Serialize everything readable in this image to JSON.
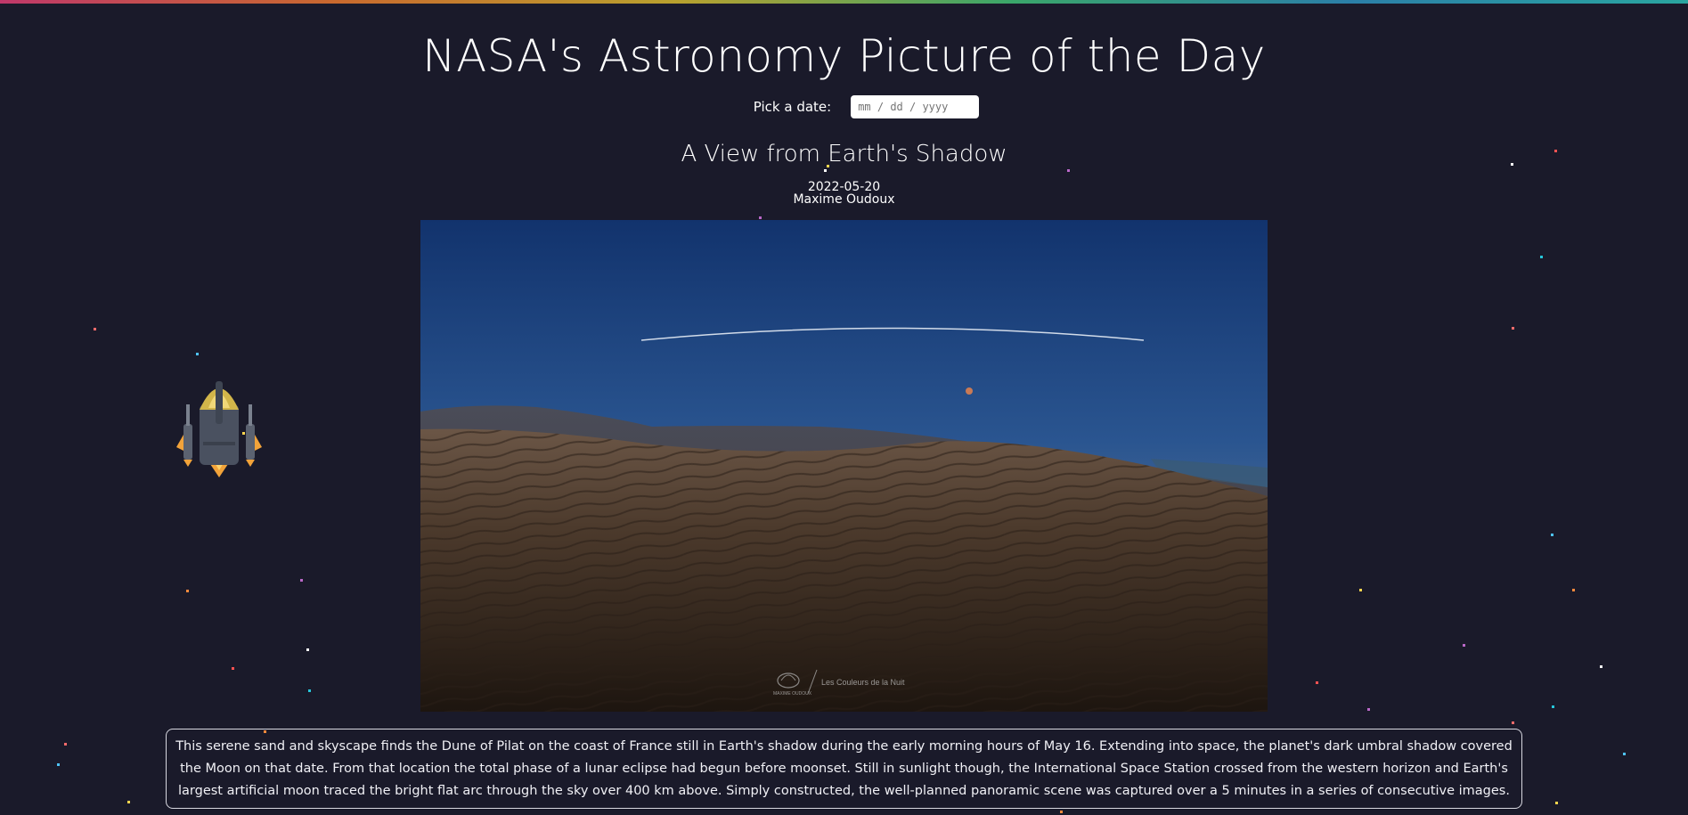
{
  "page": {
    "title": "NASA's Astronomy Picture of the Day"
  },
  "date_picker": {
    "label": "Pick a date:",
    "placeholder": "mm / dd / yyyy",
    "value": ""
  },
  "apod": {
    "title": "A View from Earth's Shadow",
    "date": "2022-05-20",
    "copyright": "Maxime Oudoux",
    "image_alt": "A View from Earth's Shadow",
    "watermark_text": "Les Couleurs de la Nuit",
    "watermark_logo_text": "MAXIME OUDOUX",
    "explanation": "This serene sand and skyscape finds the Dune of Pilat on the coast of France still in Earth's shadow during the early morning hours of May 16. Extending into space, the planet's dark umbral shadow covered the Moon on that date. From that location the total phase of a lunar eclipse had begun before moonset. Still in sunlight though, the International Space Station crossed from the western horizon and Earth's largest artificial moon traced the bright flat arc through the sky over 400 km above. Simply constructed, the well-planned panoramic scene was captured over a 5 minutes in a series of consecutive images."
  },
  "decorations": {
    "rocket_icon": "rocket-icon",
    "star_colors": [
      "#ff6b6b",
      "#4fc3f7",
      "#ffd54f",
      "#ff8a3d",
      "#ba68c8",
      "#ffffff",
      "#ff5252",
      "#26c6da"
    ]
  }
}
